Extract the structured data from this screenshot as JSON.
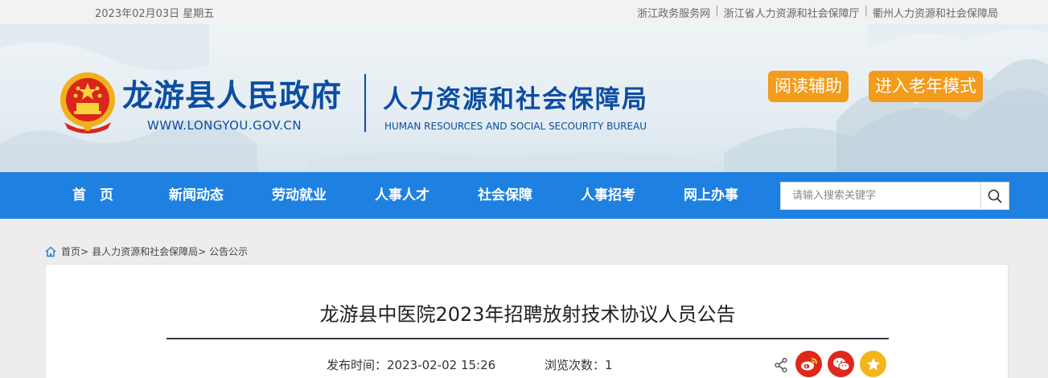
{
  "topbar": {
    "date": "2023年02月03日 星期五",
    "links": [
      "浙江政务服务网",
      "浙江省人力资源和社会保障厅",
      "衢州人力资源和社会保障局"
    ]
  },
  "header": {
    "site_name": "龙游县人民政府",
    "site_url": "WWW.LONGYOU.GOV.CN",
    "bureau_cn": "人力资源和社会保障局",
    "bureau_en": "HUMAN RESOURCES AND SOCIAL SECOURITY BUREAU",
    "reading_aid": "阅读辅助",
    "elder_mode": "进入老年模式"
  },
  "nav": {
    "items": [
      "首　页",
      "新闻动态",
      "劳动就业",
      "人事人才",
      "社会保障",
      "人事招考",
      "网上办事"
    ],
    "search_placeholder": "请输入搜索关键字"
  },
  "breadcrumb": {
    "home": "首页>",
    "bureau": "县人力资源和社会保障局>",
    "current": "公告公示"
  },
  "article": {
    "title": "龙游县中医院2023年招聘放射技术协议人员公告",
    "publish_label": "发布时间：",
    "publish_time": "2023-02-02 15:26",
    "views_label": "浏览次数：",
    "views": "1"
  },
  "colors": {
    "brand_blue": "#0c4da2",
    "nav_blue": "#1e80e1",
    "orange": "#f39b1b",
    "weibo_red": "#e0271c",
    "wechat_red": "#e0271c",
    "favorite_gold": "#f3b51b"
  },
  "icons": [
    "national-emblem-icon",
    "search-icon",
    "home-icon",
    "share-icon",
    "weibo-icon",
    "wechat-icon",
    "star-icon"
  ]
}
